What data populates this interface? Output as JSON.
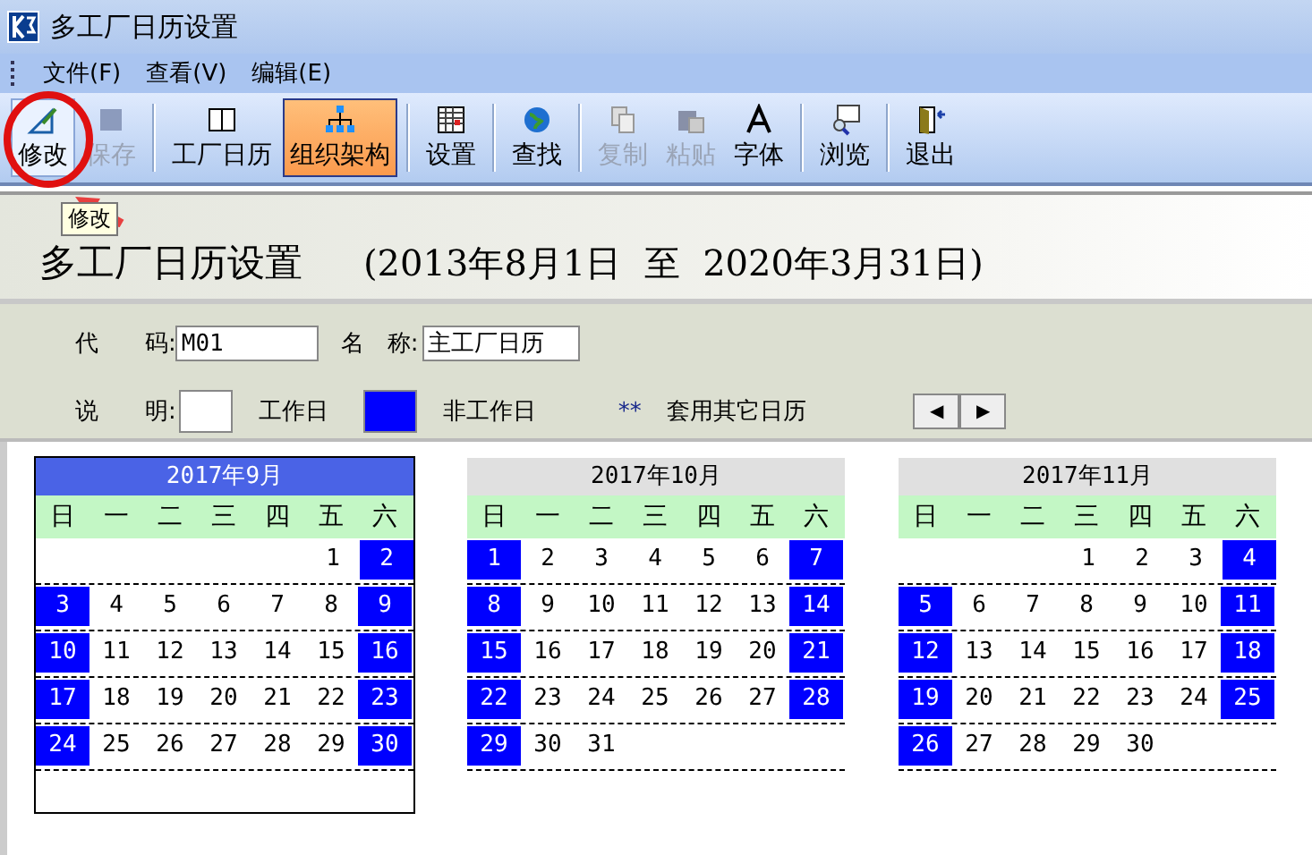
{
  "window": {
    "title": "多工厂日历设置"
  },
  "menu": [
    {
      "label": "文件(F)"
    },
    {
      "label": "查看(V)"
    },
    {
      "label": "编辑(E)"
    }
  ],
  "toolbar": [
    {
      "kind": "button",
      "label": "修改",
      "disabled": false,
      "selected": false
    },
    {
      "kind": "button",
      "label": "保存",
      "disabled": true,
      "selected": false
    },
    {
      "kind": "separator"
    },
    {
      "kind": "button",
      "label": "工厂日历",
      "disabled": false,
      "selected": false
    },
    {
      "kind": "button",
      "label": "组织架构",
      "disabled": false,
      "selected": true
    },
    {
      "kind": "separator"
    },
    {
      "kind": "button",
      "label": "设置",
      "disabled": false,
      "selected": false
    },
    {
      "kind": "separator"
    },
    {
      "kind": "button",
      "label": "查找",
      "disabled": false,
      "selected": false
    },
    {
      "kind": "separator"
    },
    {
      "kind": "button",
      "label": "复制",
      "disabled": true,
      "selected": false
    },
    {
      "kind": "button",
      "label": "粘贴",
      "disabled": true,
      "selected": false
    },
    {
      "kind": "button",
      "label": "字体",
      "disabled": false,
      "selected": false
    },
    {
      "kind": "separator"
    },
    {
      "kind": "button",
      "label": "浏览",
      "disabled": false,
      "selected": false
    },
    {
      "kind": "separator"
    },
    {
      "kind": "button",
      "label": "退出",
      "disabled": false,
      "selected": false
    }
  ],
  "tooltip": "修改",
  "heading": {
    "title": "多工厂日历设置",
    "range": "(2013年8月1日  至  2020年3月31日)"
  },
  "form": {
    "code_label": "代　　码:",
    "code": "M01",
    "name_label": "名　称:",
    "name": "主工厂日历",
    "legend_label": "说　　明:",
    "workday": "工作日",
    "nonworkday": "非工作日",
    "other_mark": "**",
    "other": "套用其它日历"
  },
  "pager": [
    "◀",
    "▶"
  ],
  "months": [
    {
      "title": "2017年9月",
      "selected": true,
      "weekdays": [
        "日",
        "一",
        "二",
        "三",
        "四",
        "五",
        "六"
      ],
      "weeks": [
        {
          "right_aligned": true,
          "days": [
            {
              "d": "1",
              "off": false
            },
            {
              "d": "2",
              "off": true
            }
          ]
        },
        {
          "right_aligned": false,
          "days": [
            {
              "d": "3",
              "off": true
            },
            {
              "d": "4",
              "off": false
            },
            {
              "d": "5",
              "off": false
            },
            {
              "d": "6",
              "off": false
            },
            {
              "d": "7",
              "off": false
            },
            {
              "d": "8",
              "off": false
            },
            {
              "d": "9",
              "off": true
            }
          ]
        },
        {
          "right_aligned": false,
          "days": [
            {
              "d": "10",
              "off": true
            },
            {
              "d": "11",
              "off": false
            },
            {
              "d": "12",
              "off": false
            },
            {
              "d": "13",
              "off": false
            },
            {
              "d": "14",
              "off": false
            },
            {
              "d": "15",
              "off": false
            },
            {
              "d": "16",
              "off": true
            }
          ]
        },
        {
          "right_aligned": false,
          "days": [
            {
              "d": "17",
              "off": true
            },
            {
              "d": "18",
              "off": false
            },
            {
              "d": "19",
              "off": false
            },
            {
              "d": "20",
              "off": false
            },
            {
              "d": "21",
              "off": false
            },
            {
              "d": "22",
              "off": false
            },
            {
              "d": "23",
              "off": true
            }
          ]
        },
        {
          "right_aligned": false,
          "days": [
            {
              "d": "24",
              "off": true
            },
            {
              "d": "25",
              "off": false
            },
            {
              "d": "26",
              "off": false
            },
            {
              "d": "27",
              "off": false
            },
            {
              "d": "28",
              "off": false
            },
            {
              "d": "29",
              "off": false
            },
            {
              "d": "30",
              "off": true
            }
          ]
        }
      ]
    },
    {
      "title": "2017年10月",
      "selected": false,
      "weekdays": [
        "日",
        "一",
        "二",
        "三",
        "四",
        "五",
        "六"
      ],
      "weeks": [
        {
          "right_aligned": false,
          "days": [
            {
              "d": "1",
              "off": true
            },
            {
              "d": "2",
              "off": false
            },
            {
              "d": "3",
              "off": false
            },
            {
              "d": "4",
              "off": false
            },
            {
              "d": "5",
              "off": false
            },
            {
              "d": "6",
              "off": false
            },
            {
              "d": "7",
              "off": true
            }
          ]
        },
        {
          "right_aligned": false,
          "days": [
            {
              "d": "8",
              "off": true
            },
            {
              "d": "9",
              "off": false
            },
            {
              "d": "10",
              "off": false
            },
            {
              "d": "11",
              "off": false
            },
            {
              "d": "12",
              "off": false
            },
            {
              "d": "13",
              "off": false
            },
            {
              "d": "14",
              "off": true
            }
          ]
        },
        {
          "right_aligned": false,
          "days": [
            {
              "d": "15",
              "off": true
            },
            {
              "d": "16",
              "off": false
            },
            {
              "d": "17",
              "off": false
            },
            {
              "d": "18",
              "off": false
            },
            {
              "d": "19",
              "off": false
            },
            {
              "d": "20",
              "off": false
            },
            {
              "d": "21",
              "off": true
            }
          ]
        },
        {
          "right_aligned": false,
          "days": [
            {
              "d": "22",
              "off": true
            },
            {
              "d": "23",
              "off": false
            },
            {
              "d": "24",
              "off": false
            },
            {
              "d": "25",
              "off": false
            },
            {
              "d": "26",
              "off": false
            },
            {
              "d": "27",
              "off": false
            },
            {
              "d": "28",
              "off": true
            }
          ]
        },
        {
          "right_aligned": false,
          "days": [
            {
              "d": "29",
              "off": true
            },
            {
              "d": "30",
              "off": false
            },
            {
              "d": "31",
              "off": false
            }
          ]
        }
      ]
    },
    {
      "title": "2017年11月",
      "selected": false,
      "weekdays": [
        "日",
        "一",
        "二",
        "三",
        "四",
        "五",
        "六"
      ],
      "weeks": [
        {
          "right_aligned": true,
          "days": [
            {
              "d": "1",
              "off": false
            },
            {
              "d": "2",
              "off": false
            },
            {
              "d": "3",
              "off": false
            },
            {
              "d": "4",
              "off": true
            }
          ]
        },
        {
          "right_aligned": false,
          "days": [
            {
              "d": "5",
              "off": true
            },
            {
              "d": "6",
              "off": false
            },
            {
              "d": "7",
              "off": false
            },
            {
              "d": "8",
              "off": false
            },
            {
              "d": "9",
              "off": false
            },
            {
              "d": "10",
              "off": false
            },
            {
              "d": "11",
              "off": true
            }
          ]
        },
        {
          "right_aligned": false,
          "days": [
            {
              "d": "12",
              "off": true
            },
            {
              "d": "13",
              "off": false
            },
            {
              "d": "14",
              "off": false
            },
            {
              "d": "15",
              "off": false
            },
            {
              "d": "16",
              "off": false
            },
            {
              "d": "17",
              "off": false
            },
            {
              "d": "18",
              "off": true
            }
          ]
        },
        {
          "right_aligned": false,
          "days": [
            {
              "d": "19",
              "off": true
            },
            {
              "d": "20",
              "off": false
            },
            {
              "d": "21",
              "off": false
            },
            {
              "d": "22",
              "off": false
            },
            {
              "d": "23",
              "off": false
            },
            {
              "d": "24",
              "off": false
            },
            {
              "d": "25",
              "off": true
            }
          ]
        },
        {
          "right_aligned": false,
          "days": [
            {
              "d": "26",
              "off": true
            },
            {
              "d": "27",
              "off": false
            },
            {
              "d": "28",
              "off": false
            },
            {
              "d": "29",
              "off": false
            },
            {
              "d": "30",
              "off": false
            }
          ]
        }
      ]
    }
  ]
}
